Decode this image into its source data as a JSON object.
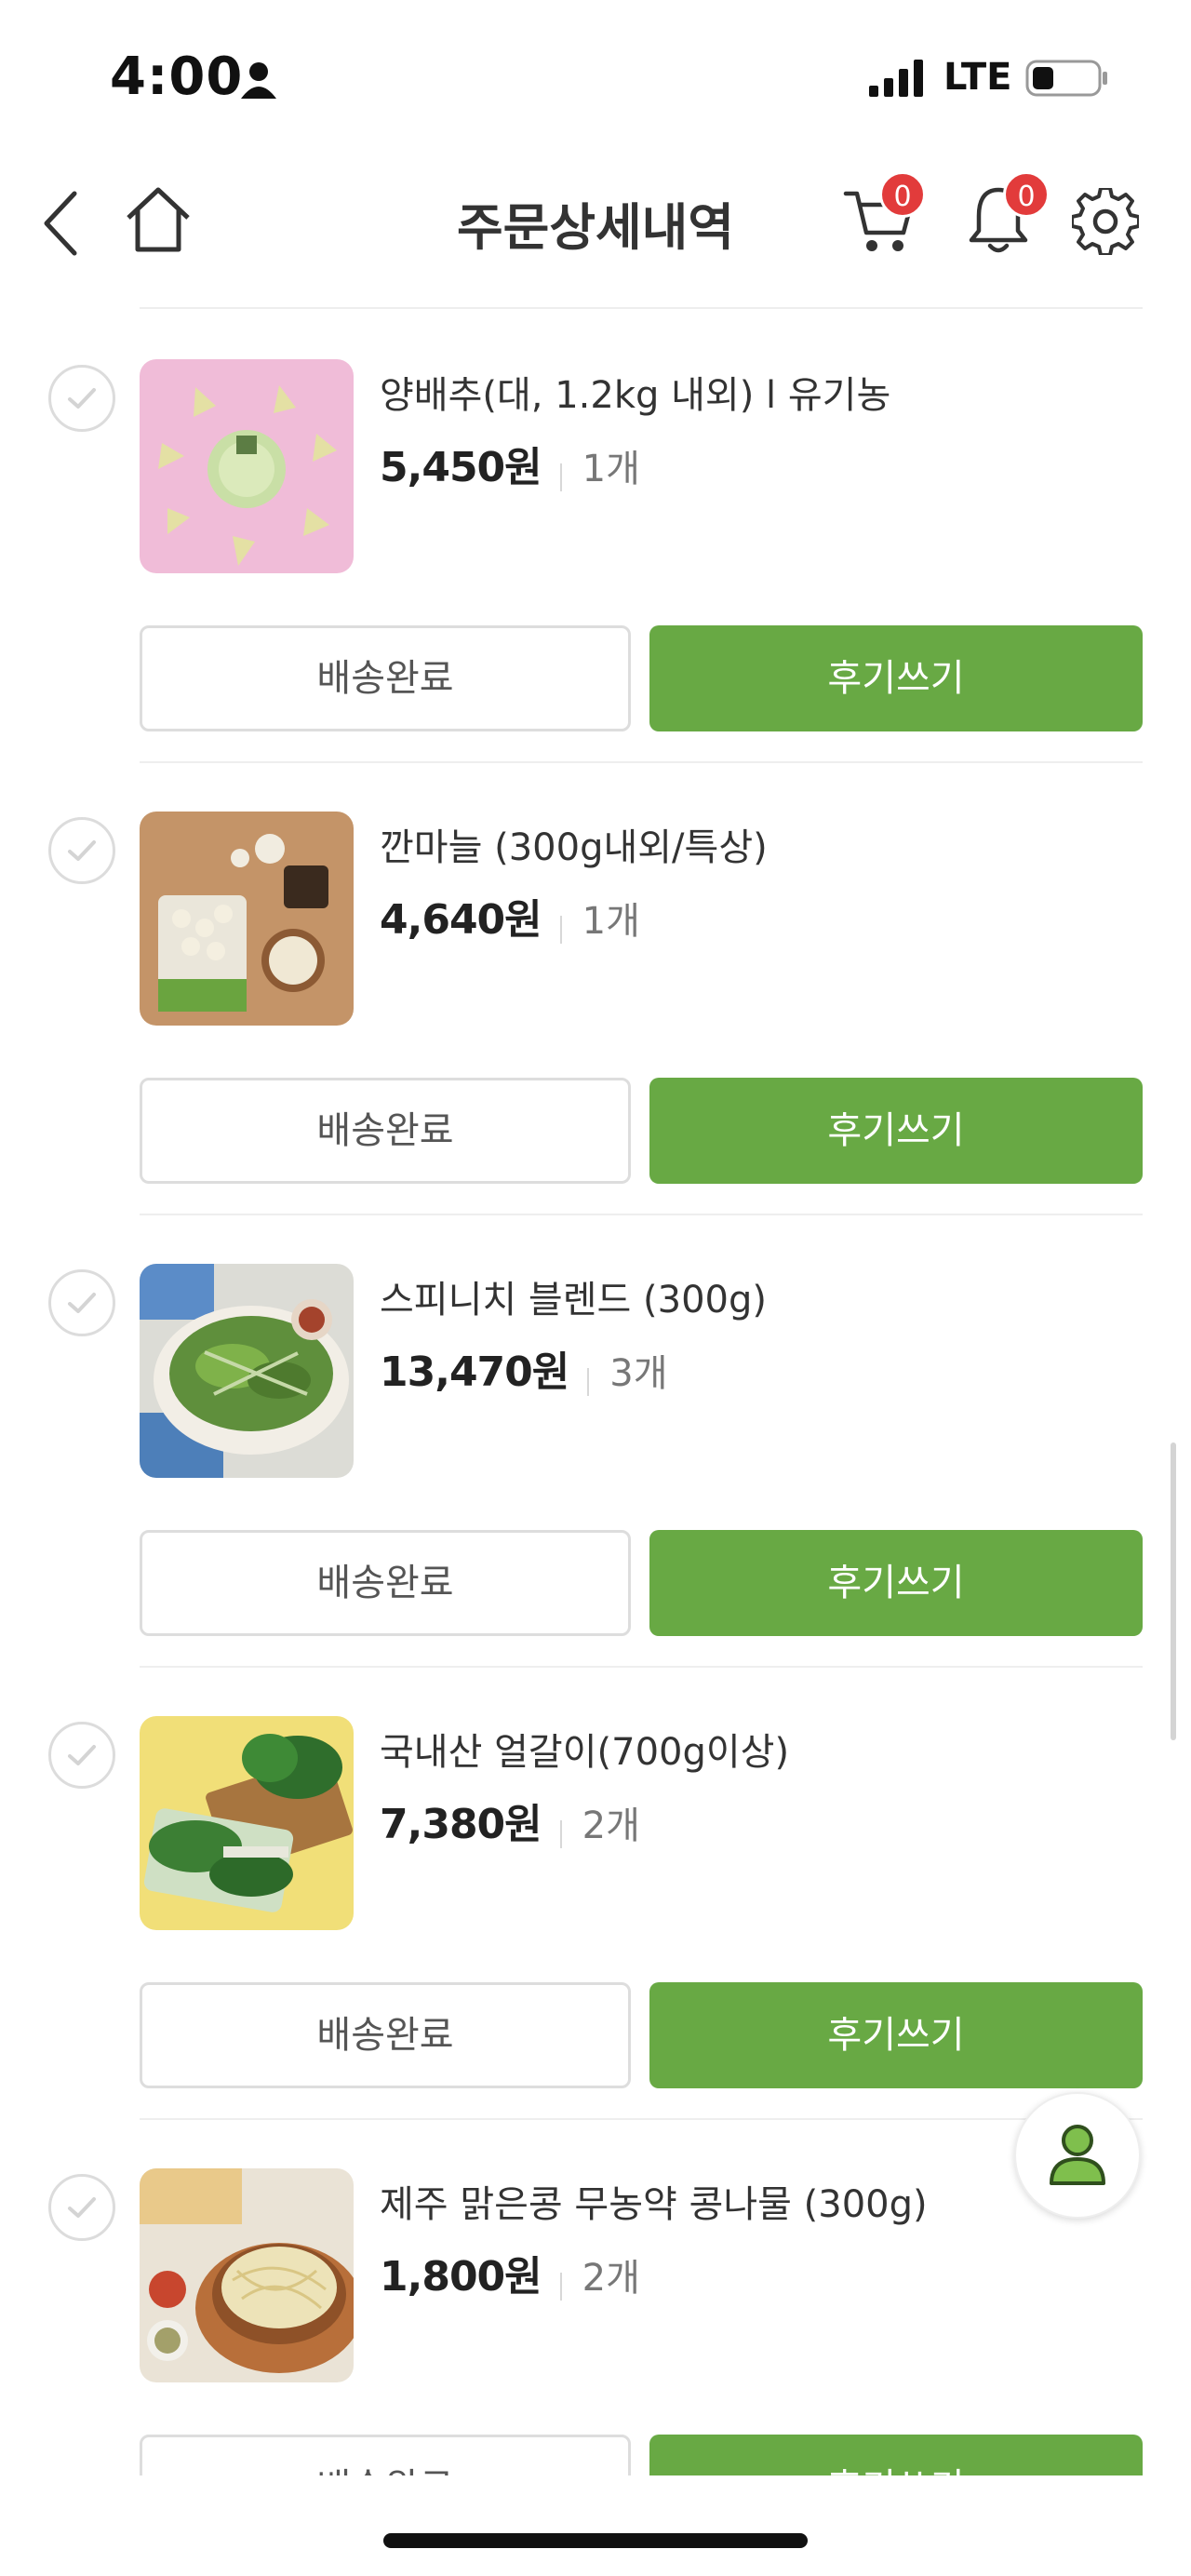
{
  "status_bar": {
    "time": "4:00",
    "network": "LTE"
  },
  "header": {
    "title": "주문상세내역",
    "cart_count": "0",
    "notification_count": "0"
  },
  "products": [
    {
      "name": "양배추(대, 1.2kg 내외) l 유기농",
      "price": "5,450원",
      "quantity": "1개",
      "status_label": "배송완료",
      "review_label": "후기쓰기"
    },
    {
      "name": "깐마늘 (300g내외/특상)",
      "price": "4,640원",
      "quantity": "1개",
      "status_label": "배송완료",
      "review_label": "후기쓰기"
    },
    {
      "name": "스피니치 블렌드 (300g)",
      "price": "13,470원",
      "quantity": "3개",
      "status_label": "배송완료",
      "review_label": "후기쓰기"
    },
    {
      "name": "국내산 얼갈이(700g이상)",
      "price": "7,380원",
      "quantity": "2개",
      "status_label": "배송완료",
      "review_label": "후기쓰기"
    },
    {
      "name": "제주 맑은콩 무농약 콩나물 (300g)",
      "price": "1,800원",
      "quantity": "2개",
      "status_label": "배송완료",
      "review_label": "후기쓰기"
    }
  ],
  "colors": {
    "accent": "#68a944",
    "badge": "#e23b3b"
  },
  "icons": [
    "back-icon",
    "home-icon",
    "cart-icon",
    "bell-icon",
    "gear-icon",
    "check-icon",
    "person-icon"
  ]
}
